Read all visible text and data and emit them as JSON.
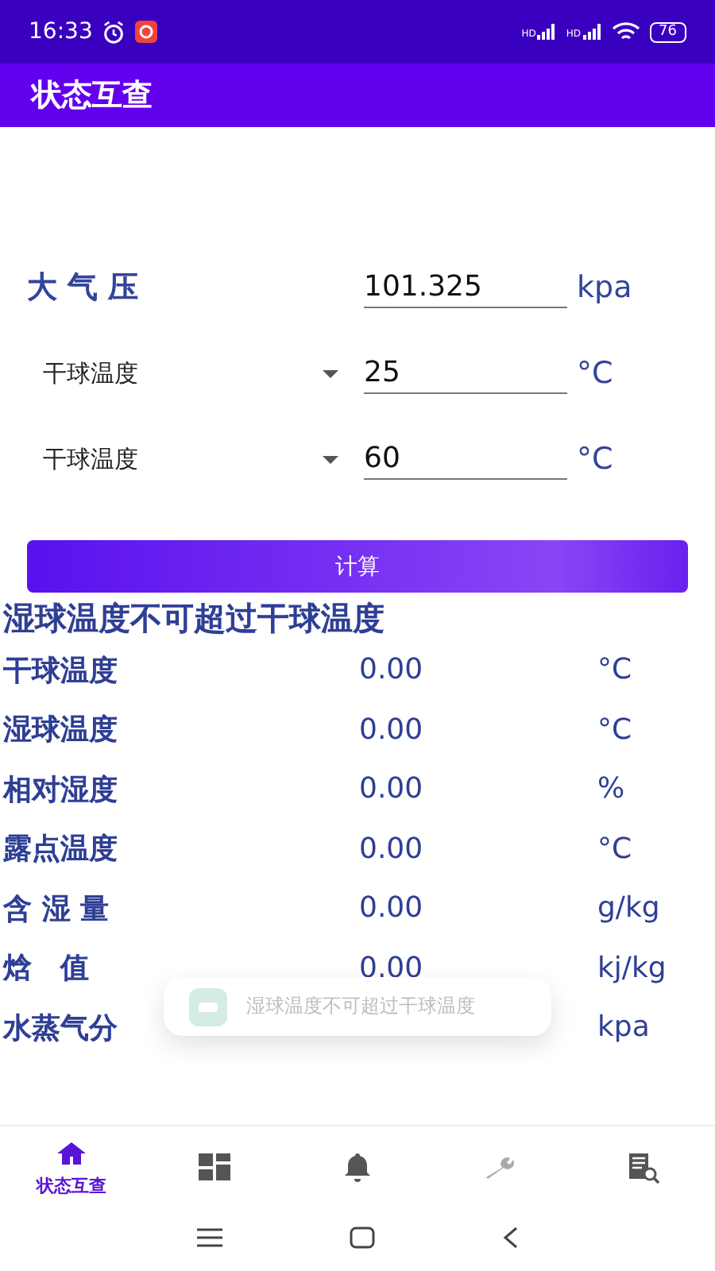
{
  "status_bar": {
    "time": "16:33",
    "network_labels": [
      "HD",
      "HD"
    ],
    "battery": "76"
  },
  "app_bar": {
    "title": "状态互查"
  },
  "pressure": {
    "label": "大 气 压",
    "value": "101.325",
    "unit": "kpa"
  },
  "inputs": [
    {
      "selector": "干球温度",
      "value": "25",
      "unit": "°C"
    },
    {
      "selector": "干球温度",
      "value": "60",
      "unit": "°C"
    }
  ],
  "calculate_button": "计算",
  "warning": "湿球温度不可超过干球温度",
  "results": [
    {
      "label": "干球温度",
      "value": "0.00",
      "unit": "°C"
    },
    {
      "label": "湿球温度",
      "value": "0.00",
      "unit": "°C"
    },
    {
      "label": "相对湿度",
      "value": "0.00",
      "unit": "%"
    },
    {
      "label": "露点温度",
      "value": "0.00",
      "unit": "°C"
    },
    {
      "label": "含 湿 量",
      "value": "0.00",
      "unit": "g/kg"
    },
    {
      "label": "焓　值",
      "value": "0.00",
      "unit": "kj/kg"
    },
    {
      "label": "水蒸气分",
      "unit": "kpa"
    }
  ],
  "toast": {
    "text": "湿球温度不可超过干球温度"
  },
  "bottom_nav": [
    {
      "kind": "home",
      "label": "状态互查",
      "selected": true
    },
    {
      "kind": "grid",
      "selected": false
    },
    {
      "kind": "bell",
      "selected": false
    },
    {
      "kind": "wrench",
      "selected": false
    },
    {
      "kind": "report",
      "selected": false
    }
  ]
}
